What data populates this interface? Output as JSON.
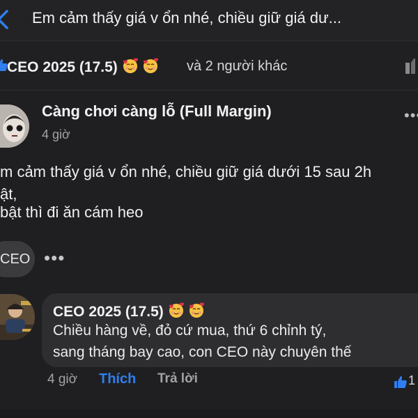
{
  "header": {
    "title": "Em cảm thấy giá v ổn nhé, chiều giữ giá dư..."
  },
  "reactions": {
    "user_label": "CEO 2025 (17.5)",
    "emoji_names": [
      "smiling-face-with-hearts",
      "smiling-face-with-hearts"
    ],
    "others_text": "và 2 người khác"
  },
  "post": {
    "author": "Càng chơi càng lỗ (Full Margin)",
    "time": "4 giờ",
    "lines": [
      "m cảm thấy giá v ổn nhé, chiều giữ giá dưới 15 sau 2h",
      "ật,",
      " bật thì đi ăn cám heo"
    ],
    "tag": "CEO"
  },
  "comment": {
    "author": "CEO 2025 (17.5)",
    "emoji_names": [
      "smiling-face-with-hearts",
      "smiling-face-with-hearts"
    ],
    "lines": [
      "Chiều hàng về, đỏ cứ mua, thứ 6 chỉnh tý,",
      "sang tháng bay cao, con CEO này chuyên thế"
    ],
    "time": "4 giờ",
    "like_label": "Thích",
    "reply_label": "Trả lời",
    "like_count": "1"
  },
  "colors": {
    "accent": "#2f7ff0",
    "background": "#1f1f21",
    "bubble": "#2e2e31"
  }
}
